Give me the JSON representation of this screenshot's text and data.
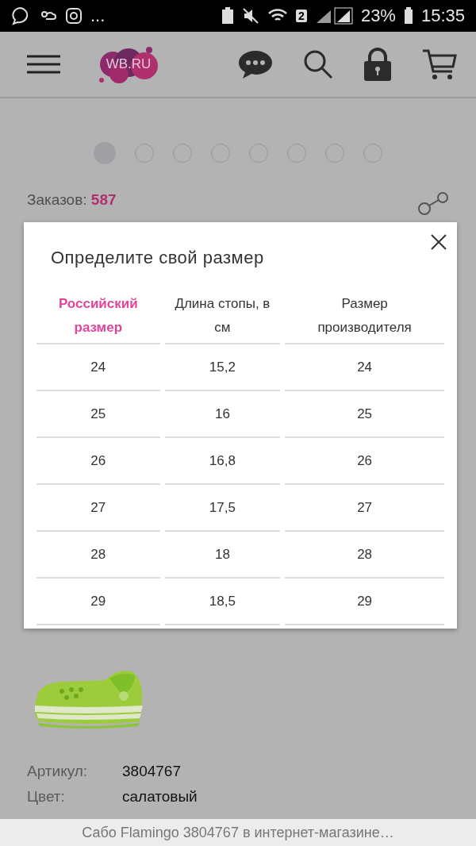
{
  "status_bar": {
    "overflow": "...",
    "sim_badge": "2",
    "battery": "23%",
    "time": "15:35"
  },
  "header": {
    "logo": "WB.RU"
  },
  "gallery": {
    "dots": [
      {
        "selected": true
      },
      {
        "selected": false
      },
      {
        "selected": false
      },
      {
        "selected": false
      },
      {
        "selected": false
      },
      {
        "selected": false
      },
      {
        "selected": false
      },
      {
        "selected": false
      }
    ]
  },
  "orders": {
    "label": "Заказов:",
    "value": "587"
  },
  "size_dialog": {
    "title": "Определите свой размер",
    "columns": [
      {
        "label": "Российский размер",
        "selected": true
      },
      {
        "label": "Длина стопы, в см",
        "selected": false
      },
      {
        "label": "Размер производителя",
        "selected": false
      }
    ],
    "rows": [
      [
        "24",
        "15,2",
        "24"
      ],
      [
        "25",
        "16",
        "25"
      ],
      [
        "26",
        "16,8",
        "26"
      ],
      [
        "27",
        "17,5",
        "27"
      ],
      [
        "28",
        "18",
        "28"
      ],
      [
        "29",
        "18,5",
        "29"
      ]
    ]
  },
  "product": {
    "details": [
      {
        "label": "Артикул:",
        "value": "3804767"
      },
      {
        "label": "Цвет:",
        "value": "салатовый"
      }
    ]
  },
  "footer": {
    "title": "Сабо Flamingo 3804767 в интернет-магазине…"
  }
}
